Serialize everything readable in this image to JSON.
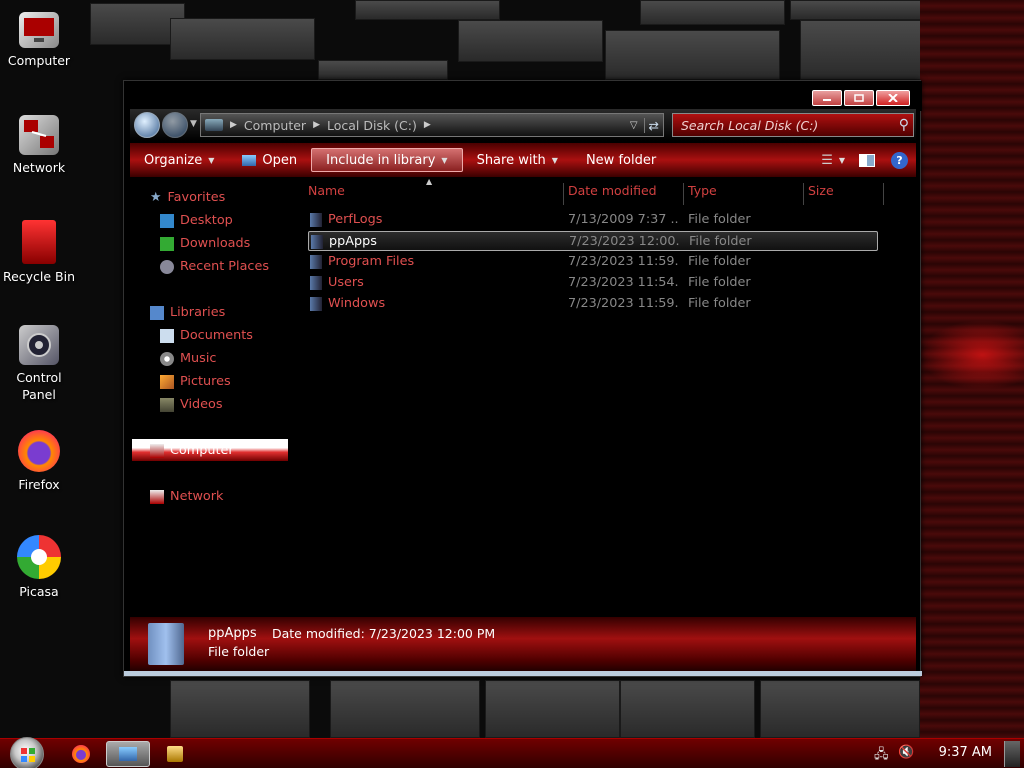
{
  "desktop": {
    "icons": [
      {
        "label": "Computer",
        "icon": "computer-icon"
      },
      {
        "label": "Network",
        "icon": "network-icon"
      },
      {
        "label": "Recycle Bin",
        "icon": "recycle-bin-icon"
      },
      {
        "label": "Control\nPanel",
        "icon": "control-panel-icon"
      },
      {
        "label": "Firefox",
        "icon": "firefox-icon"
      },
      {
        "label": "Picasa",
        "icon": "picasa-icon"
      }
    ]
  },
  "window": {
    "breadcrumb": [
      "Computer",
      "Local Disk (C:)"
    ],
    "search_placeholder": "Search Local Disk (C:)",
    "toolbar": {
      "organize": "Organize",
      "open": "Open",
      "include_in_library": "Include in library",
      "share_with": "Share with",
      "new_folder": "New folder"
    },
    "nav": {
      "favorites": "Favorites",
      "desktop": "Desktop",
      "downloads": "Downloads",
      "recent_places": "Recent Places",
      "libraries": "Libraries",
      "documents": "Documents",
      "music": "Music",
      "pictures": "Pictures",
      "videos": "Videos",
      "computer": "Computer",
      "network": "Network"
    },
    "columns": {
      "name": "Name",
      "date_modified": "Date modified",
      "type": "Type",
      "size": "Size"
    },
    "files": [
      {
        "name": "PerfLogs",
        "date": "7/13/2009 7:37 ...",
        "type": "File folder"
      },
      {
        "name": "ppApps",
        "date": "7/23/2023 12:00...",
        "type": "File folder"
      },
      {
        "name": "Program Files",
        "date": "7/23/2023 11:59...",
        "type": "File folder"
      },
      {
        "name": "Users",
        "date": "7/23/2023 11:54...",
        "type": "File folder"
      },
      {
        "name": "Windows",
        "date": "7/23/2023 11:59...",
        "type": "File folder"
      }
    ],
    "details": {
      "name": "ppApps",
      "modified": "Date modified: 7/23/2023 12:00 PM",
      "type": "File folder"
    }
  },
  "taskbar": {
    "clock": "9:37 AM"
  },
  "colors": {
    "accent": "#e05050",
    "toolbar": "#aa1010"
  }
}
